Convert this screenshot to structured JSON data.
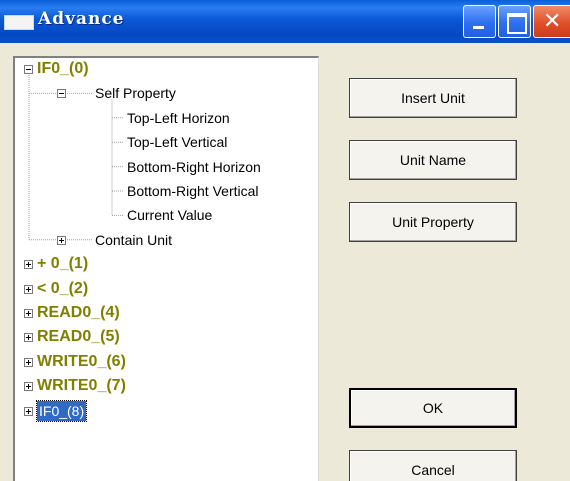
{
  "window": {
    "title": "Advance"
  },
  "tree": {
    "nodes": [
      {
        "label": "IF0_(0)",
        "level": 0,
        "expander": "minus"
      },
      {
        "label": "Self Property",
        "level": 1,
        "expander": "minus"
      },
      {
        "label": "Top-Left Horizon",
        "level": 2
      },
      {
        "label": "Top-Left Vertical",
        "level": 2
      },
      {
        "label": "Bottom-Right Horizon",
        "level": 2
      },
      {
        "label": "Bottom-Right Vertical",
        "level": 2
      },
      {
        "label": "Current Value",
        "level": 2
      },
      {
        "label": "Contain Unit",
        "level": 1,
        "expander": "plus"
      },
      {
        "label": "+ 0_(1)",
        "level": 0,
        "expander": "plus"
      },
      {
        "label": "< 0_(2)",
        "level": 0,
        "expander": "plus"
      },
      {
        "label": "READ0_(4)",
        "level": 0,
        "expander": "plus"
      },
      {
        "label": "READ0_(5)",
        "level": 0,
        "expander": "plus"
      },
      {
        "label": "WRITE0_(6)",
        "level": 0,
        "expander": "plus"
      },
      {
        "label": "WRITE0_(7)",
        "level": 0,
        "expander": "plus"
      },
      {
        "label": "IF0_(8)",
        "level": 0,
        "expander": "plus",
        "selected": true
      }
    ]
  },
  "buttons": {
    "insert_unit": "Insert Unit",
    "unit_name": "Unit Name",
    "unit_property": "Unit Property",
    "ok": "OK",
    "cancel": "Cancel"
  },
  "colors": {
    "title_bar": "#0a58d6",
    "top_level_text": "#808000",
    "selection": "#316ac5",
    "dialog_background": "#ece9d8"
  }
}
